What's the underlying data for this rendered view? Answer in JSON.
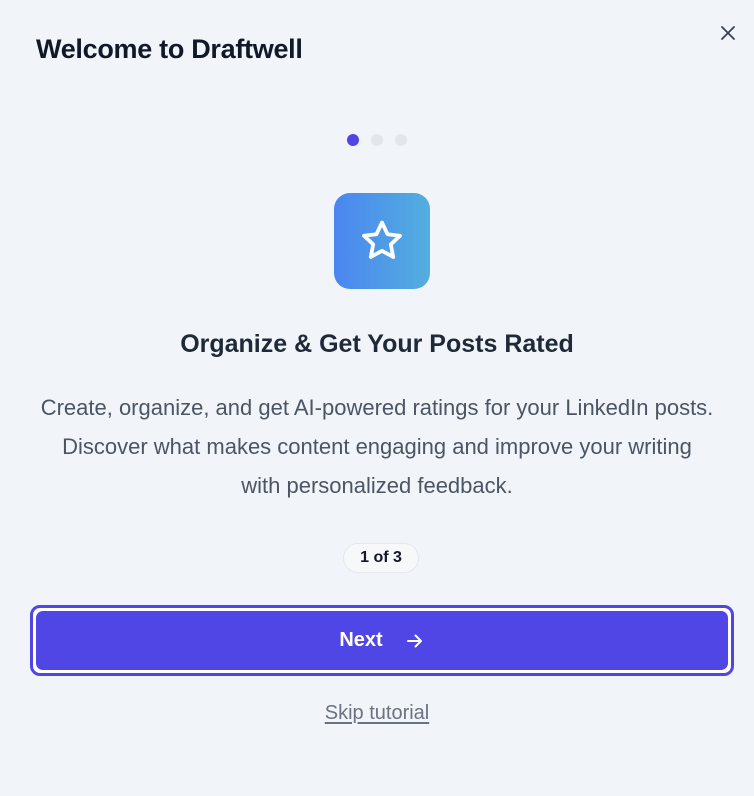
{
  "dialog": {
    "title": "Welcome to Draftwell",
    "close_icon": "close-icon"
  },
  "progress": {
    "total_steps": 3,
    "current_step": 1,
    "active_color": "#4f46e5",
    "inactive_color": "#e2e6ec",
    "label": "1 of 3"
  },
  "step": {
    "icon": "star-icon",
    "heading": "Organize & Get Your Posts Rated",
    "description": "Create, organize, and get AI-powered ratings for your LinkedIn posts. Discover what makes content engaging and improve your writing with personalized feedback."
  },
  "actions": {
    "next_label": "Next",
    "next_icon": "arrow-right-icon",
    "skip_label": "Skip tutorial"
  },
  "colors": {
    "accent": "#4f46e5",
    "hero_gradient_start": "#4a86f0",
    "hero_gradient_end": "#53aede"
  }
}
